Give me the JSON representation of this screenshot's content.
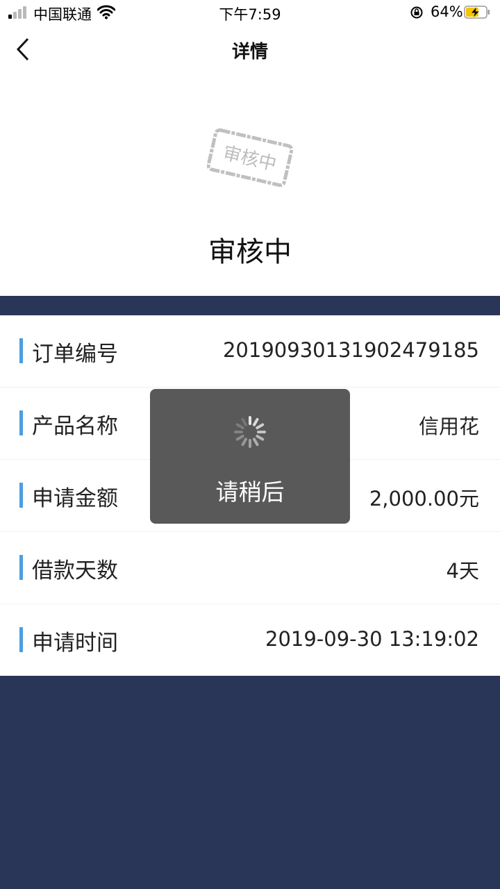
{
  "status_bar": {
    "carrier": "中国联通",
    "time": "下午7:59",
    "battery_percent": "64%",
    "signal_bars_active": 1,
    "battery_level": 0.64
  },
  "nav": {
    "title": "详情",
    "back_icon": "chevron-left-icon"
  },
  "review": {
    "stamp_text": "审核中",
    "status_text": "审核中"
  },
  "details": {
    "rows": [
      {
        "label": "订单编号",
        "value": "20190930131902479185"
      },
      {
        "label": "产品名称",
        "value": "信用花"
      },
      {
        "label": "申请金额",
        "value": "2,000.00元"
      },
      {
        "label": "借款天数",
        "value": "4天"
      },
      {
        "label": "申请时间",
        "value": "2019-09-30 13:19:02"
      }
    ]
  },
  "loading_toast": {
    "text": "请稍后"
  },
  "colors": {
    "accent_bar": "#4d9de0",
    "background_navy": "#2a3658",
    "toast_bg": "#505050"
  }
}
